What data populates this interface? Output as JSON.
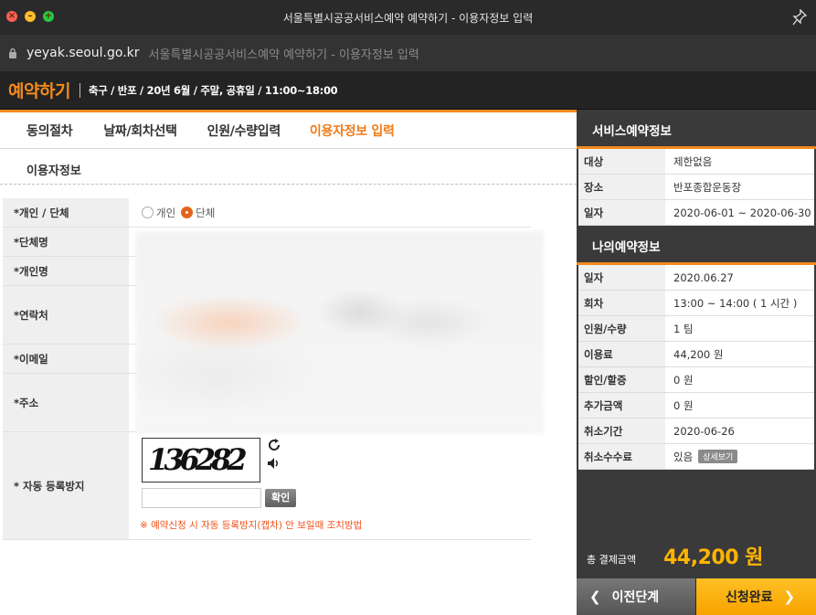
{
  "window": {
    "title": "서울특별시공공서비스예약 예약하기 - 이용자정보 입력"
  },
  "address": {
    "host": "yeyak.seoul.go.kr",
    "page_title": "서울특별시공공서비스예약 예약하기 - 이용자정보 입력"
  },
  "header": {
    "brand": "예약하기",
    "subtitle": "축구 / 반포 / 20년 6월 / 주말, 공휴일 / 11:00~18:00"
  },
  "tabs": [
    {
      "label": "동의절차",
      "active": false
    },
    {
      "label": "날짜/회차선택",
      "active": false
    },
    {
      "label": "인원/수량입력",
      "active": false
    },
    {
      "label": "이용자정보 입력",
      "active": true
    }
  ],
  "section_title": "이용자정보",
  "form": {
    "type_label": "*개인 / 단체",
    "type_options": [
      "개인",
      "단체"
    ],
    "type_selected": "단체",
    "group_name_label": "*단체명",
    "person_name_label": "*개인명",
    "contact_label": "*연락처",
    "email_label": "*이메일",
    "address_label": "*주소",
    "captcha_label": "* 자동 등록방지",
    "captcha_text": "136282",
    "captcha_confirm": "확인",
    "captcha_note": "※ 예약신청 시 자동 등록방지(캡차) 안 보일때 조치방법"
  },
  "service_info": {
    "title": "서비스예약정보",
    "rows": [
      {
        "key": "대상",
        "value": "제한없음"
      },
      {
        "key": "장소",
        "value": "반포종합운동장"
      },
      {
        "key": "일자",
        "value": "2020-06-01 ~ 2020-06-30"
      }
    ]
  },
  "my_reservation": {
    "title": "나의예약정보",
    "rows": [
      {
        "key": "일자",
        "value": "2020.06.27"
      },
      {
        "key": "회차",
        "value": "13:00 ~ 14:00 ( 1 시간 )"
      },
      {
        "key": "인원/수량",
        "value": "1 팀"
      },
      {
        "key": "이용료",
        "value": "44,200 원"
      },
      {
        "key": "할인/할증",
        "value": "0 원"
      },
      {
        "key": "추가금액",
        "value": "0 원"
      },
      {
        "key": "취소기간",
        "value": "2020-06-26"
      },
      {
        "key": "취소수수료",
        "value": "있음"
      }
    ],
    "detail_button": "상세보기"
  },
  "total": {
    "label": "총 결제금액",
    "amount": "44,200 원"
  },
  "buttons": {
    "prev": "이전단계",
    "next": "신청완료"
  },
  "colors": {
    "accent": "#f28a1e",
    "total_amount": "#ffb400",
    "next_button": "#f7a300",
    "note": "#f0531b"
  }
}
